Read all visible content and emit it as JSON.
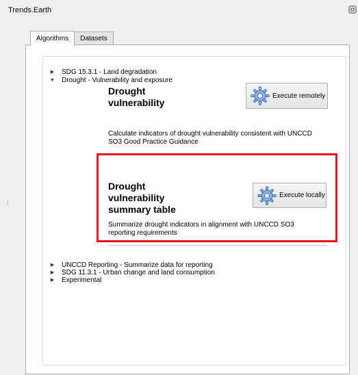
{
  "window": {
    "title": "Trends.Earth"
  },
  "tabs": [
    {
      "label": "Algorithms",
      "active": true
    },
    {
      "label": "Datasets",
      "active": false
    }
  ],
  "tree": {
    "top_groups": [
      {
        "label": "SDG 15.3.1 - Land degradation",
        "expanded": false
      },
      {
        "label": "Drought - Vulnerability and exposure",
        "expanded": true
      }
    ],
    "cards": [
      {
        "title_lines": [
          "Drought",
          "vulnerability"
        ],
        "button_label": "Execute remotely",
        "button_icon": "gear-icon",
        "description_lines": [
          "Calculate indicators of drought vulnerability consistent with UNCCD",
          "SO3 Good Practice Guidance"
        ]
      },
      {
        "title_lines": [
          "Drought",
          "vulnerability",
          "summary table"
        ],
        "button_label": "Execute locally",
        "button_icon": "gear-icon",
        "description_lines": [
          "Summarize drought indicators in alignment with UNCCD SO3",
          "reporting requirements"
        ]
      }
    ],
    "bottom_groups": [
      {
        "label": "UNCCD Reporting - Summarize data for reporting",
        "expanded": false
      },
      {
        "label": "SDG 11.3.1 - Urban change and land consumption",
        "expanded": false
      },
      {
        "label": "Experimental",
        "expanded": false
      }
    ]
  },
  "colors": {
    "highlight": "#e3151d",
    "gear_fill": "#8fb3e3",
    "gear_stroke": "#3f6fb5"
  }
}
